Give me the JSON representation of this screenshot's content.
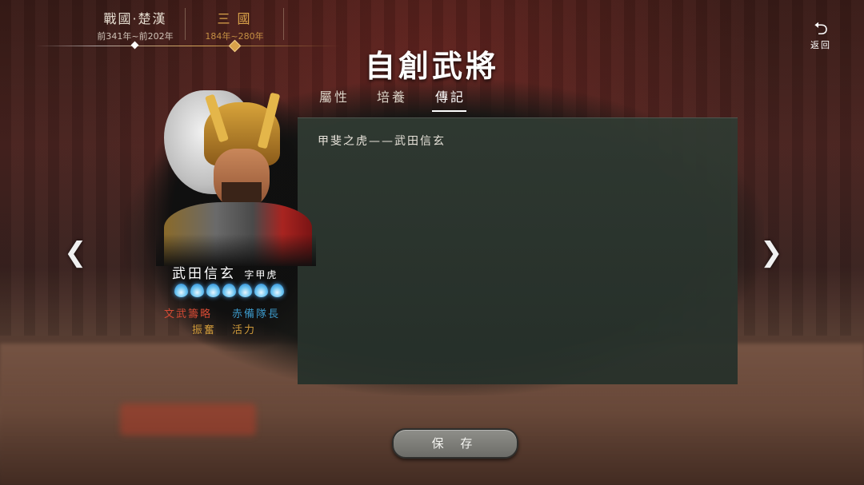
{
  "eras": [
    {
      "name": "戰國·楚漢",
      "years": "前341年~前202年",
      "active": false
    },
    {
      "name": "三 國",
      "years": "184年~280年",
      "active": true
    }
  ],
  "back": {
    "icon": "return-arrow-icon",
    "label": "返回"
  },
  "title": "自創武將",
  "tabs": [
    "屬性",
    "培養",
    "傳記"
  ],
  "active_tab": "傳記",
  "bio_text": "甲斐之虎——武田信玄",
  "general": {
    "name": "武田信玄",
    "courtesy": "字甲虎",
    "drop_count": 7,
    "skills": [
      "文武籌略",
      "赤備隊長",
      "振奮",
      "活力"
    ]
  },
  "nav": {
    "left_icon": "chevron-left-icon",
    "right_icon": "chevron-right-icon"
  },
  "save_label": "保 存",
  "colors": {
    "active_era": "#d9a24a",
    "skill_red": "#d64a34",
    "skill_blue": "#3c98c8",
    "skill_gold": "#cf9a3a"
  }
}
